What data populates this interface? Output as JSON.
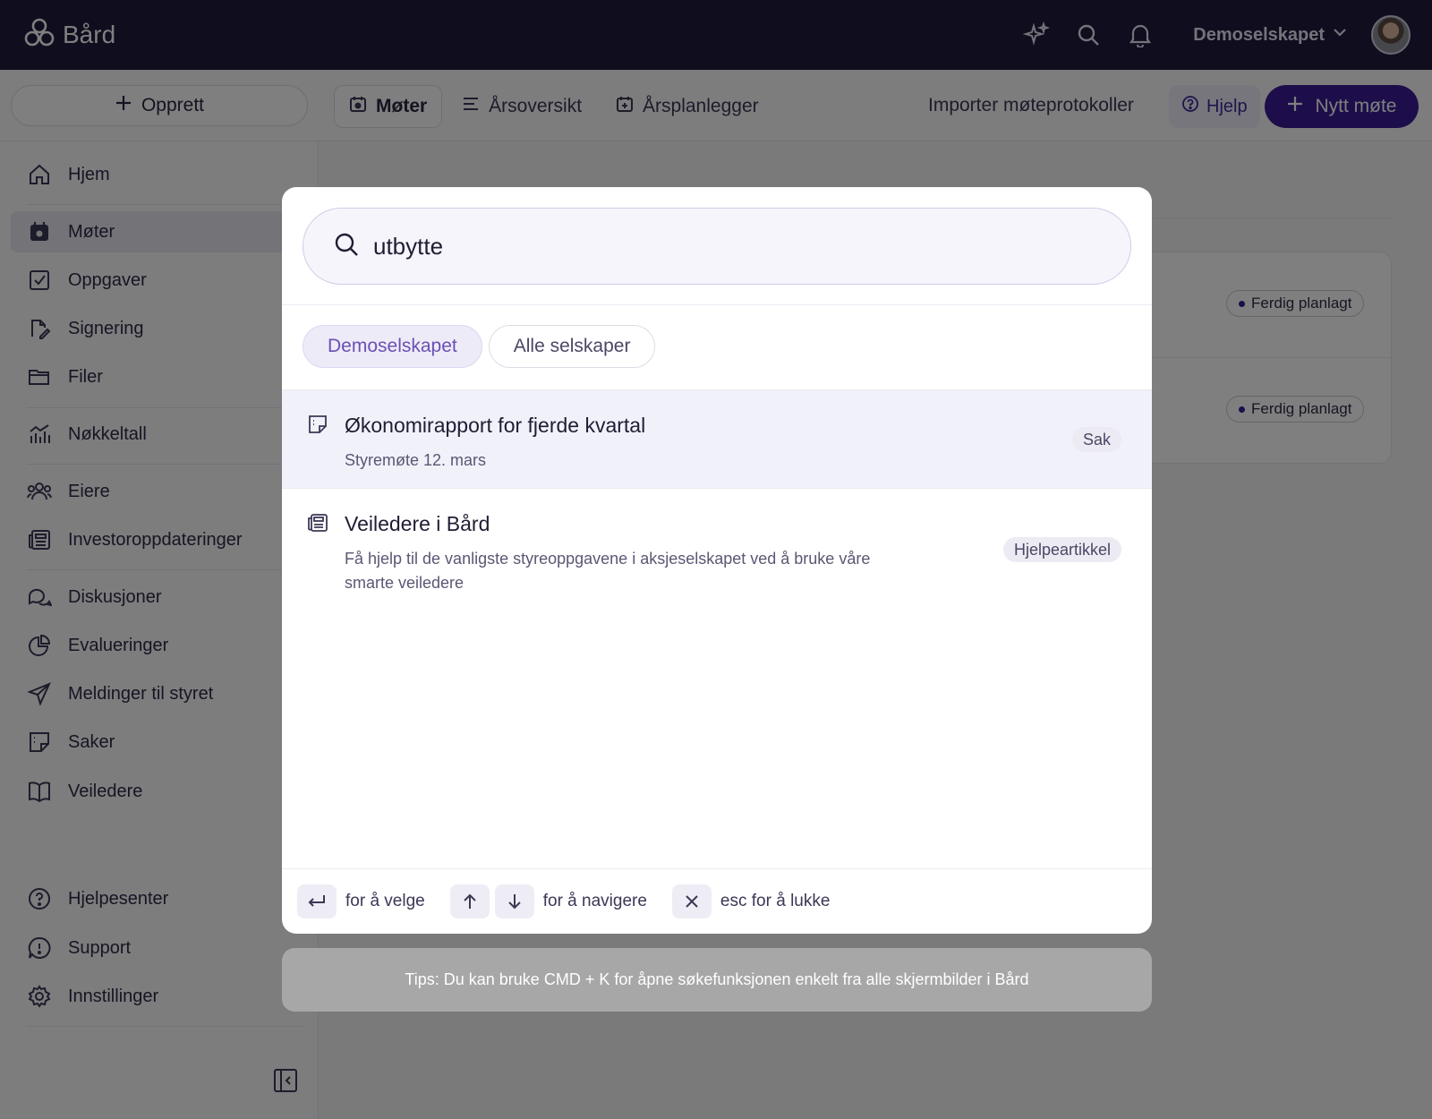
{
  "app": {
    "name": "Bård"
  },
  "topbar": {
    "company": "Demoselskapet"
  },
  "subheader": {
    "create_label": "Opprett",
    "tabs": [
      {
        "label": "Møter",
        "active": true
      },
      {
        "label": "Årsoversikt",
        "active": false
      },
      {
        "label": "Årsplanlegger",
        "active": false
      }
    ],
    "import_label": "Importer møteprotokoller",
    "help_label": "Hjelp",
    "new_meeting_label": "Nytt møte"
  },
  "sidebar": {
    "items": [
      {
        "label": "Hjem",
        "icon": "home-icon"
      },
      {
        "label": "Møter",
        "icon": "calendar-icon",
        "active": true
      },
      {
        "label": "Oppgaver",
        "icon": "checkbox-icon"
      },
      {
        "label": "Signering",
        "icon": "signature-icon"
      },
      {
        "label": "Filer",
        "icon": "folder-icon"
      },
      {
        "label": "Nøkkeltall",
        "icon": "chart-icon"
      },
      {
        "label": "Eiere",
        "icon": "users-icon"
      },
      {
        "label": "Investoroppdateringer",
        "icon": "newspaper-icon"
      },
      {
        "label": "Diskusjoner",
        "icon": "chat-icon"
      },
      {
        "label": "Evalueringer",
        "icon": "pie-chart-icon"
      },
      {
        "label": "Meldinger til styret",
        "icon": "send-icon"
      },
      {
        "label": "Saker",
        "icon": "note-icon"
      },
      {
        "label": "Veiledere",
        "icon": "book-icon"
      }
    ],
    "bottom_items": [
      {
        "label": "Hjelpesenter",
        "icon": "help-circle-icon"
      },
      {
        "label": "Support",
        "icon": "alert-bubble-icon"
      },
      {
        "label": "Innstillinger",
        "icon": "gear-icon"
      }
    ]
  },
  "main": {
    "status_chips": [
      "Ferdig planlagt",
      "Ferdig planlagt"
    ]
  },
  "search_modal": {
    "query": "utbytte",
    "scopes": [
      {
        "label": "Demoselskapet",
        "active": true
      },
      {
        "label": "Alle selskaper",
        "active": false
      }
    ],
    "results": [
      {
        "title": "Økonomirapport for fjerde kvartal",
        "subtitle": "Styremøte 12. mars",
        "badge": "Sak",
        "icon": "note-icon",
        "selected": true
      },
      {
        "title": "Veiledere i Bård",
        "subtitle": "Få hjelp til de vanligste styreoppgavene i aksjeselskapet ved å bruke våre smarte veiledere",
        "badge": "Hjelpeartikkel",
        "icon": "newspaper-icon",
        "selected": false
      }
    ],
    "footer": {
      "select_hint": "for å velge",
      "navigate_hint": "for å navigere",
      "close_hint": "esc for å lukke"
    }
  },
  "tip": "Tips: Du kan bruke CMD + K for åpne søkefunksjonen enkelt fra alle skjermbilder i Bård",
  "colors": {
    "topbar": "#1e1a3d",
    "primary": "#3a1c96",
    "accent_text": "#6b4fb4"
  }
}
